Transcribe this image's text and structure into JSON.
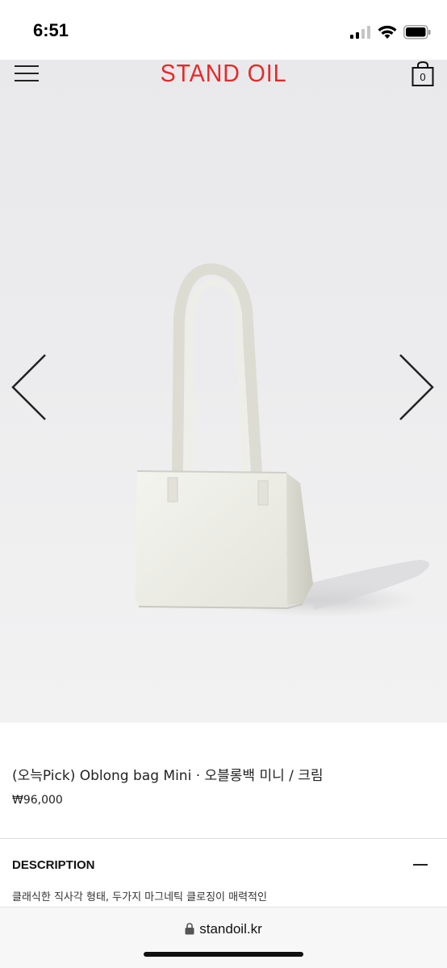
{
  "status_bar": {
    "time": "6:51",
    "icons": [
      "signal-icon",
      "wifi-icon",
      "battery-icon"
    ]
  },
  "header": {
    "menu_icon": "hamburger-icon",
    "brand": "STAND OIL",
    "brand_color": "#e52a2a",
    "cart_icon": "shopping-bag-icon",
    "cart_count": "0"
  },
  "gallery": {
    "prev_icon": "chevron-left-icon",
    "next_icon": "chevron-right-icon",
    "image": "white-shoulder-bag-photo"
  },
  "product": {
    "title": "(오늑Pick) Oblong bag Mini · 오블롱백 미니 / 크림",
    "price": "₩96,000"
  },
  "description": {
    "heading": "DESCRIPTION",
    "toggle_icon": "minus-icon",
    "text": "클래식한 직사각 형태, 두가지 마그네틱 클로징이 매력적인"
  },
  "browser": {
    "lock_icon": "lock-icon",
    "url": "standoil.kr"
  }
}
